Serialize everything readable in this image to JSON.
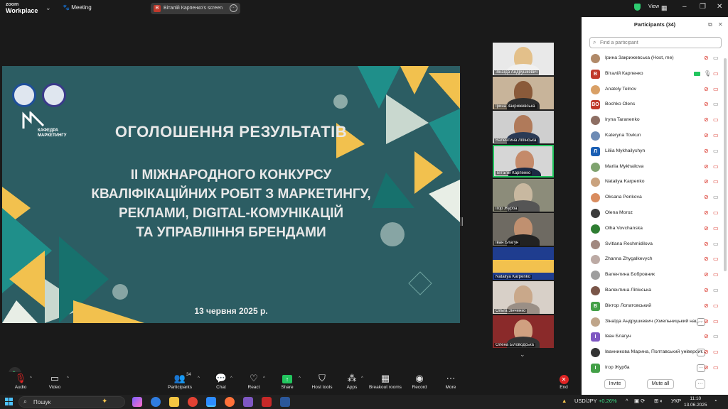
{
  "topbar": {
    "logo_top": "zoom",
    "logo_bottom": "Workplace",
    "meeting_label": "Meeting",
    "screen_owner_badge": "В",
    "screen_label": "Віталій Карпенко's screen",
    "view_label": "View"
  },
  "slide": {
    "kafedra_line1": "КАФЕДРА",
    "kafedra_line2": "МАРКЕТИНГУ",
    "heading": "ОГОЛОШЕННЯ РЕЗУЛЬТАТІВ",
    "line1": "ІІ МІЖНАРОДНОГО КОНКУРСУ",
    "line2": "КВАЛІФІКАЦІЙНИХ РОБІТ З МАРКЕТИНГУ,",
    "line3": "РЕКЛАМИ, DIGITAL-КОМУНІКАЦІЙ",
    "line4": "ТА УПРАВЛІННЯ БРЕНДАМИ",
    "date": "13 червня 2025 р.",
    "colors": {
      "background": "#2c5d63",
      "yellow": "#f2c14e",
      "teal": "#1f8f8a",
      "light": "#c9d8cf"
    }
  },
  "video_strip": [
    {
      "name": "Зінаїда Андрушкевич"
    },
    {
      "name": "Ірина Закрижевська"
    },
    {
      "name": "Валентина Ліпінська"
    },
    {
      "name": "Віталій Карпенко"
    },
    {
      "name": "Ігор Журба"
    },
    {
      "name": "Іван Благун"
    },
    {
      "name": "Nataliya Karpenko"
    },
    {
      "name": "Ольга Зінченко"
    },
    {
      "name": "Олена Біловодська"
    }
  ],
  "toolbar": {
    "audio": "Audio",
    "video": "Video",
    "participants": "Participants",
    "participants_count": "34",
    "chat": "Chat",
    "react": "React",
    "share": "Share",
    "host_tools": "Host tools",
    "apps": "Apps",
    "breakout": "Breakout rooms",
    "record": "Record",
    "more": "More",
    "end": "End"
  },
  "panel": {
    "title": "Participants (34)",
    "search_placeholder": "Find a participant",
    "participants": [
      {
        "name": "Ірина Закрижевська (Host, me)",
        "avatar": "",
        "color": "#b08968"
      },
      {
        "name": "Віталій Карпенко",
        "avatar": "В",
        "color": "#c0392b"
      },
      {
        "name": "Anatoly Telnov",
        "avatar": "",
        "color": "#d9a066"
      },
      {
        "name": "Bochko Olens",
        "avatar": "BO",
        "color": "#c0392b"
      },
      {
        "name": "Iryna Taranenko",
        "avatar": "",
        "color": "#8d6e63"
      },
      {
        "name": "Kateryna Tovkun",
        "avatar": "",
        "color": "#6d8bb5"
      },
      {
        "name": "Liliia Mykhailyshyn",
        "avatar": "Л",
        "color": "#1a5fb4"
      },
      {
        "name": "Mariia Mykhailova",
        "avatar": "",
        "color": "#7fa36f"
      },
      {
        "name": "Nataliya Karpenko",
        "avatar": "",
        "color": "#c9a27e"
      },
      {
        "name": "Oksana Penkova",
        "avatar": "",
        "color": "#d98c5f"
      },
      {
        "name": "Olena Moroz",
        "avatar": "",
        "color": "#3b3b3b"
      },
      {
        "name": "Olha Vovchanska",
        "avatar": "",
        "color": "#2e7d32"
      },
      {
        "name": "Svitlana Reshmidilova",
        "avatar": "",
        "color": "#a1887f"
      },
      {
        "name": "Zhanna Zhygalkevych",
        "avatar": "",
        "color": "#bcaaa4"
      },
      {
        "name": "Валентина Бобровник",
        "avatar": "",
        "color": "#9e9e9e"
      },
      {
        "name": "Валентина Ліпінська",
        "avatar": "",
        "color": "#795548"
      },
      {
        "name": "Віктор Лопатовський",
        "avatar": "В",
        "color": "#43a047"
      },
      {
        "name": "Зінаїда Андрушкевич (Хмельницький нац...",
        "avatar": "",
        "color": "#bfa58a"
      },
      {
        "name": "Іван Благун",
        "avatar": "І",
        "color": "#7e57c2"
      },
      {
        "name": "Іванникова Марина, Полтавський університ...",
        "avatar": "",
        "color": "#333333"
      },
      {
        "name": "Ігор Журба",
        "avatar": "І",
        "color": "#43a047"
      }
    ],
    "invite": "Invite",
    "mute_all": "Mute all"
  },
  "taskbar": {
    "search_text": "Пошук",
    "ticker": "USD/JPY",
    "ticker_change": "+0.26%",
    "lang": "УКР",
    "time": "11:10",
    "date": "13.06.2025"
  }
}
